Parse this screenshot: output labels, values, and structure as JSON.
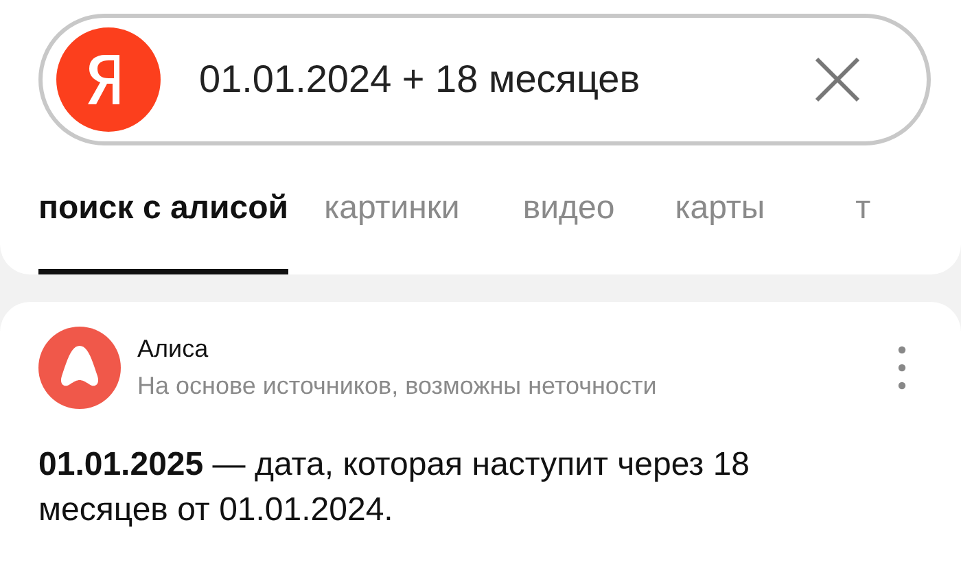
{
  "search": {
    "value": "01.01.2024 + 18 месяцев"
  },
  "tabs": [
    {
      "label": "поиск с алисой",
      "selected": true
    },
    {
      "label": "картинки",
      "selected": false
    },
    {
      "label": "видео",
      "selected": false
    },
    {
      "label": "карты",
      "selected": false
    },
    {
      "label": "т",
      "selected": false
    }
  ],
  "answer_card": {
    "source": "Алиса",
    "disclaimer": "На основе источников, возможны неточности",
    "answer": "**01.01.2025** — дата, которая наступит через 18 месяцев от 01.01.2024."
  }
}
